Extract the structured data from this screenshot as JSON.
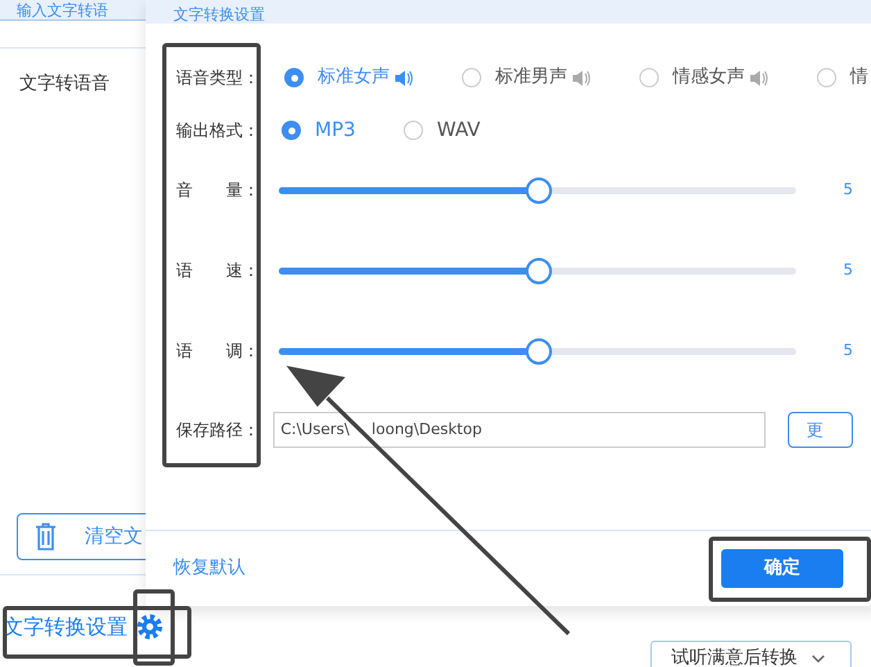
{
  "left_panel": {
    "tab": "输入文字转语",
    "item": "文字转语音",
    "clear_button": "清空文"
  },
  "dialog": {
    "title": "文字转换设置",
    "voice": {
      "label": "语音类型：",
      "options": [
        {
          "label": "标准女声",
          "selected": true,
          "speaker": true
        },
        {
          "label": "标准男声",
          "selected": false,
          "speaker": true
        },
        {
          "label": "情感女声",
          "selected": false,
          "speaker": true
        },
        {
          "label": "情",
          "selected": false,
          "speaker": false
        }
      ]
    },
    "format": {
      "label": "输出格式：",
      "options": [
        {
          "label": "MP3",
          "selected": true
        },
        {
          "label": "WAV",
          "selected": false
        }
      ]
    },
    "sliders": [
      {
        "label": "音　　量：",
        "level": 0.5,
        "reading": "5"
      },
      {
        "label": "语　　速：",
        "level": 0.5,
        "reading": "5"
      },
      {
        "label": "语　　调：",
        "level": 0.5,
        "reading": "5"
      }
    ],
    "path": {
      "label": "保存路径：",
      "value_start": "C:\\Users\\",
      "value_end": "loong\\Desktop",
      "button": "更"
    },
    "reset": "恢复默认",
    "ok": "确定"
  },
  "bottom": {
    "settings_link": "文字转换设置",
    "preview_button": "试听满意后转换"
  }
}
